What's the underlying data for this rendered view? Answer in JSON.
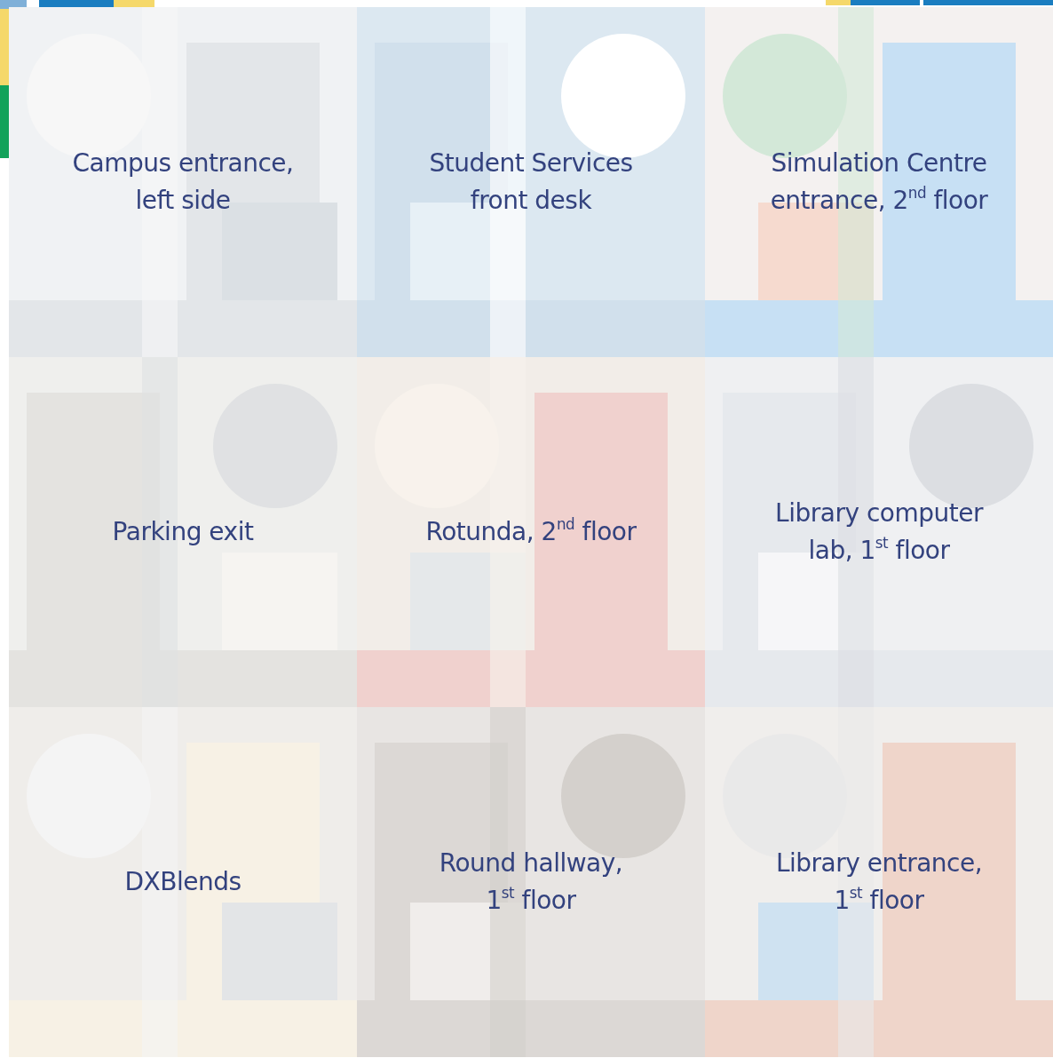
{
  "tiles": [
    {
      "kind": "picture",
      "caption": [
        "Campus entrance,",
        "left side"
      ]
    },
    {
      "kind": "picture",
      "caption": [
        "Student Services",
        "front desk"
      ]
    },
    {
      "kind": "picture",
      "caption": [
        "Simulation Centre",
        "entrance, 2$^{nd}$ floor"
      ]
    },
    {
      "kind": "picture",
      "caption": [
        "Parking exit"
      ]
    },
    {
      "kind": "picture",
      "caption": [
        "Rotunda, 2$^{nd}$ floor"
      ]
    },
    {
      "kind": "picture",
      "caption": [
        "Library computer",
        "lab, 1$^{st}$ floor"
      ]
    },
    {
      "kind": "picture",
      "caption": [
        "DXBlends"
      ]
    },
    {
      "kind": "picture",
      "caption": [
        "Round hallway,",
        "1$^{st}$ floor"
      ]
    },
    {
      "kind": "picture",
      "caption": [
        "Library entrance,",
        "1$^{st}$ floor"
      ]
    }
  ]
}
